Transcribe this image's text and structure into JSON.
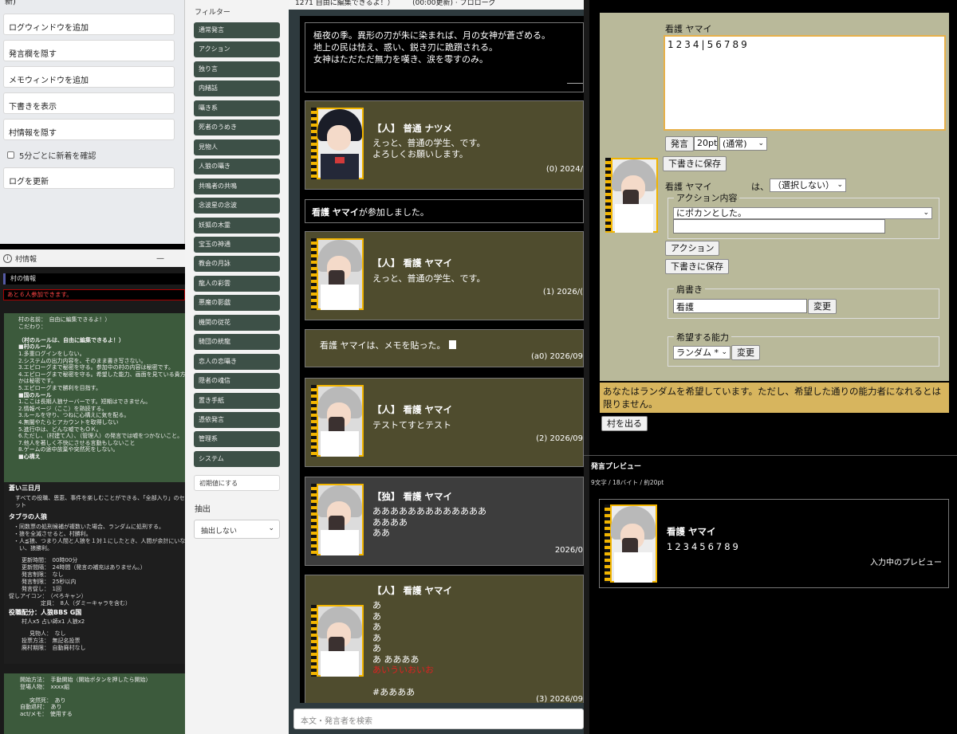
{
  "left_menu": {
    "header": "新)",
    "buttons": [
      "ログウィンドウを追加",
      "発言欄を隠す",
      "メモウィンドウを追加",
      "下書きを表示",
      "村情報を隠す"
    ],
    "checkbox_label": "5分ごとに新着を確認",
    "refresh_button": "ログを更新"
  },
  "village_info": {
    "window_title": "村情報",
    "minimize_glyph": "—",
    "section_header": "村の情報",
    "warning": "あと６人参加できます。",
    "block1": [
      "村の名前：　自由に編集できるよ！）",
      "こだわり：",
      "",
      "（村のルールは、自由に編集できるよ！）",
      "■村のルール",
      "1.多重ログインをしない。",
      "2.システムの出力内容を、そのまま書き写さない。",
      "3.エピローグまで秘密を守る。参加中の村の内容は秘密です。",
      "4.エピローグまで秘密を守る。希望した能力、画面を見ている貴方",
      "かは秘密です。",
      "5.エピローグまで勝利を目指す。",
      "■国のルール",
      "1.ここは長期人狼サーバーです。短期はできません。",
      "2.情報ページ（ここ）を熟読する。",
      "3.ルールを守り、つねに心構えに気を配る。",
      "4.無闇やたらとアカウントを取得しない",
      "5.進行中は、どんな嘘でもＯＫ。",
      "6.ただし、（村建て人）、（管理人）の発言では嘘をつかないこと。",
      "7.他人を著しく不快にさせる言動もしないこと",
      "8.ゲームの途中放棄や突然死をしない。",
      "■心構え"
    ],
    "block2_title": "蒼い三日月",
    "block2": [
      "すべての役職、恩恵、事件を楽しむことができる、「全部入り」のセ",
      "ット"
    ],
    "block2_sub": "タブラの人狼",
    "block2_list": [
      "・同数票の処刑候補が複数いた場合、ランダムに処刑する。",
      "・狼を全滅させると、村勝利。",
      "・人≦狼、つまり人間と人狼を１対１にしたとき、人間が余計にいな",
      "　い、狼勝利。"
    ],
    "block2_info": [
      "更新時間：　00時00分",
      "更新間隔：　24時間（発言の補充はありません。）",
      "発言制限：　なし",
      "発言制限：　25秒以内",
      "発言促し：　1回",
      "促しアイコン：　（ぺろキャン）",
      "定員：　8人（ダミーキャラを含む）"
    ],
    "block2_role_title": "役職配分：人狼BBS G国",
    "block2_role": "村人x5 占い師x1 人狼x2",
    "block2_info2": [
      "見物人：　なし",
      "投票方法：　無記名投票",
      "廃村期限：　自動廃村なし"
    ],
    "block3": [
      "開始方法：　手動開始（開始ボタンを押したら開始）",
      "登場人物：　xxxx組",
      "",
      "突然死：　あり",
      "自動退村：　あり",
      "act/メモ：　使用する"
    ]
  },
  "filter": {
    "title": "フィルター",
    "buttons": [
      "通常発言",
      "アクション",
      "独り言",
      "内緒話",
      "囁き系",
      "死者のうめき",
      "見物人",
      "人狼の囁き",
      "共鳴者の共鳴",
      "念波星の念波",
      "妖狐の木霊",
      "宝玉の神通",
      "教会の月詠",
      "龍人の彩雲",
      "悪魔の影戯",
      "機関の従花",
      "騎団の統龍",
      "恋人の恋囁き",
      "隠者の魂信",
      "置き手紙",
      "憑依発言",
      "管理系",
      "システム"
    ],
    "reset_button": "初期値にする",
    "extract_label": "抽出",
    "extract_select": "抽出しない",
    "chevron": "⌄"
  },
  "log": {
    "topbar": "1271 自由に編集できるよ！）　　　(00:00更新) · プロローグ",
    "intro": [
      "極夜の季。異形の刃が朱に染まれば、月の女神が蒼ざめる。",
      "地上の民は怯え、惑い、鋭き刃に跪躓される。",
      "女神はただただ無力を嘆き、涙を零すのみ。"
    ],
    "posts": [
      {
        "name": "【人】 普通 ナツメ",
        "lines": [
          "えっと、普通の学生、です。",
          "よろしくお願いします。"
        ],
        "meta": "(0) 2024/"
      },
      {
        "name": "【人】 看護 ヤマイ",
        "lines": [
          "えっと、普通の学生、です。"
        ],
        "meta": "(1) 2026/("
      },
      {
        "name": "【人】 看護 ヤマイ",
        "lines": [
          "テストてすとテスト"
        ],
        "meta": "(2) 2026/09"
      },
      {
        "name": "【独】 看護 ヤマイ",
        "lines": [
          "あああああああああああああ",
          "ああああ",
          "ああ"
        ],
        "meta": "2026/0"
      },
      {
        "name": "【人】 看護 ヤマイ",
        "lines": [
          "あ",
          "あ",
          "あ",
          "あ",
          "あ",
          "あ ああああ"
        ],
        "red_line": "あいういおいお",
        "hash_line": "#ああああ",
        "meta": "(3) 2026/09"
      }
    ],
    "join_name": "看護 ヤマイ",
    "join_suffix": "が参加しました。",
    "memo": "看護 ヤマイは、メモを貼った。",
    "memo_meta": "(a0) 2026/09",
    "search_placeholder": "本文・発言者を検索"
  },
  "right": {
    "speaker_name": "看護 ヤマイ",
    "textarea_value": "1234|56789",
    "say_button": "発言",
    "size_value": "20pt",
    "mode_select": "(通常)",
    "save_draft_1": "下書きに保存",
    "action_speaker": "看護 ヤマイ",
    "action_ha": "は、",
    "action_target": "（選択しない）",
    "action_legend": "アクション内容",
    "action_select": "にポカンとした。",
    "action_button": "アクション",
    "save_draft_2": "下書きに保存",
    "title_legend": "肩書き",
    "title_value": "看護",
    "change_button": "変更",
    "ability_legend": "希望する能力",
    "ability_select": "ランダム *",
    "change_button_2": "変更",
    "notice": "あなたはランダムを希望しています。ただし、希望した通りの能力者になれるとは限りません。",
    "leave_button": "村を出る",
    "preview_title": "発言プレビュー",
    "preview_stats": "9文字 / 18バイト / 約20pt",
    "preview_name": "看護 ヤマイ",
    "preview_body": "123456789",
    "preview_note": "入力中のプレビュー",
    "chevron": "⌄"
  }
}
